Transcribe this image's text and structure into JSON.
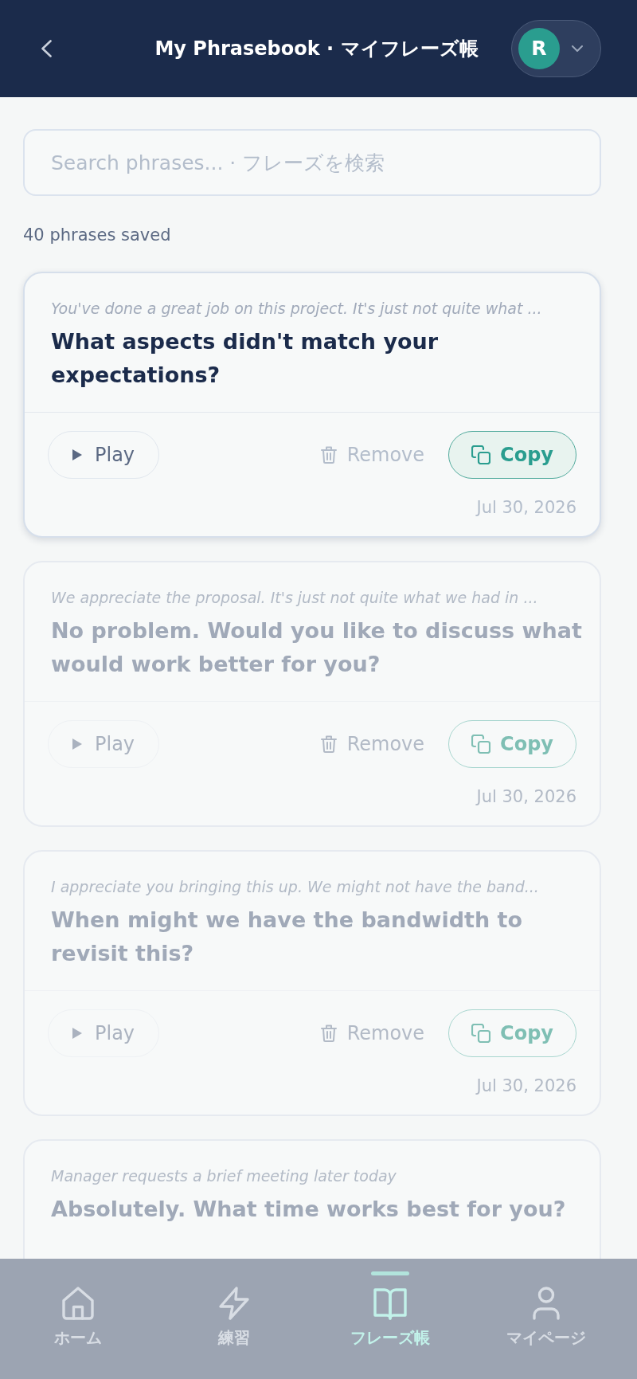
{
  "header": {
    "title": "My Phrasebook · マイフレーズ帳",
    "avatar_initial": "R"
  },
  "search": {
    "placeholder": "Search phrases... · フレーズを検索"
  },
  "count": "40 phrases saved",
  "cards": [
    {
      "context": "You've done a great job on this project. It's just not quite what ...",
      "phrase": "What aspects didn't match your expectations?",
      "dimmed": false,
      "buttons": [
        {
          "kind": "play",
          "label": "Play"
        },
        {
          "kind": "remove",
          "label": "Remove"
        },
        {
          "kind": "copy",
          "label": "Copy"
        }
      ],
      "date": "Jul 30, 2026"
    },
    {
      "context": "We appreciate the proposal. It's just not quite what we had in ...",
      "phrase": "No problem. Would you like to discuss what would work better for you?",
      "dimmed": true,
      "buttons": [
        {
          "kind": "play",
          "label": "Play"
        },
        {
          "kind": "remove",
          "label": "Remove"
        },
        {
          "kind": "copy",
          "label": "Copy"
        }
      ],
      "date": "Jul 30, 2026"
    },
    {
      "context": "I appreciate you bringing this up. We might not have the band...",
      "phrase": "When might we have the bandwidth to revisit this?",
      "dimmed": true,
      "buttons": [
        {
          "kind": "play",
          "label": "Play"
        },
        {
          "kind": "remove",
          "label": "Remove"
        },
        {
          "kind": "copy",
          "label": "Copy"
        }
      ],
      "date": "Jul 30, 2026"
    },
    {
      "context": "Manager requests a brief meeting later today",
      "phrase": "Absolutely. What time works best for you?",
      "dimmed": true
    }
  ],
  "bottom_nav": [
    {
      "label": "ホーム",
      "selected": false
    },
    {
      "label": "練習",
      "selected": false
    },
    {
      "label": "フレーズ帳",
      "selected": true
    },
    {
      "label": "マイページ",
      "selected": false
    }
  ]
}
